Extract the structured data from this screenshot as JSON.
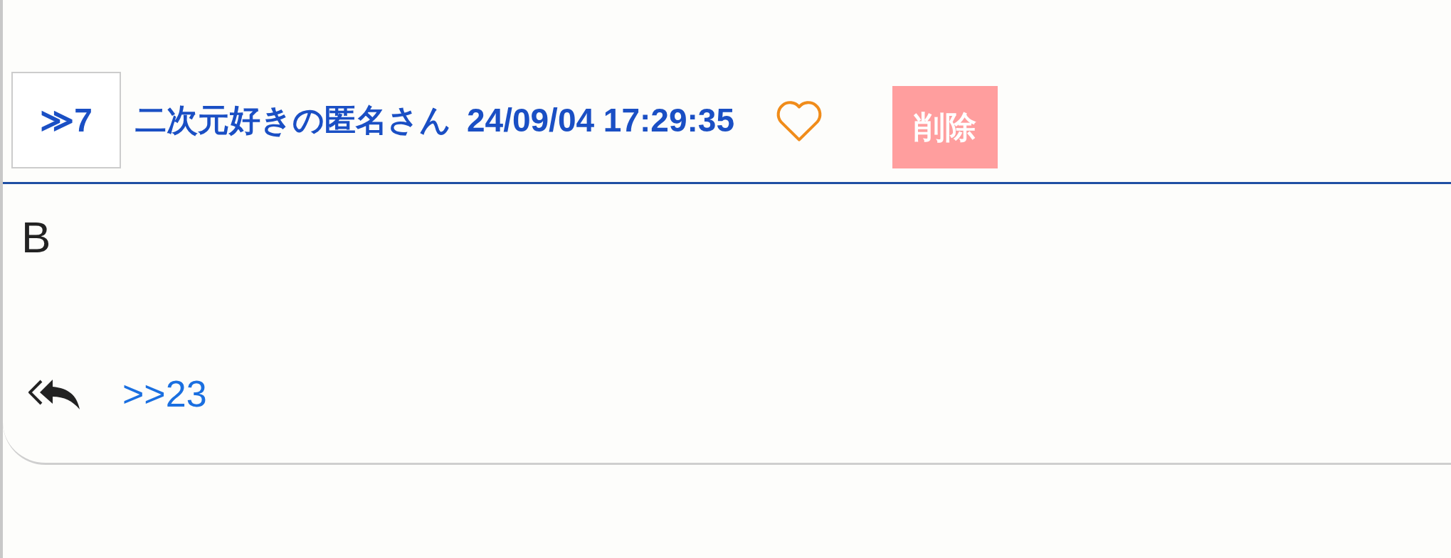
{
  "post": {
    "number": "≫7",
    "author": "二次元好きの匿名さん",
    "timestamp": "24/09/04 17:29:35",
    "liked": false,
    "delete_label": "削除",
    "body": "B",
    "replies": [
      ">>23"
    ]
  }
}
